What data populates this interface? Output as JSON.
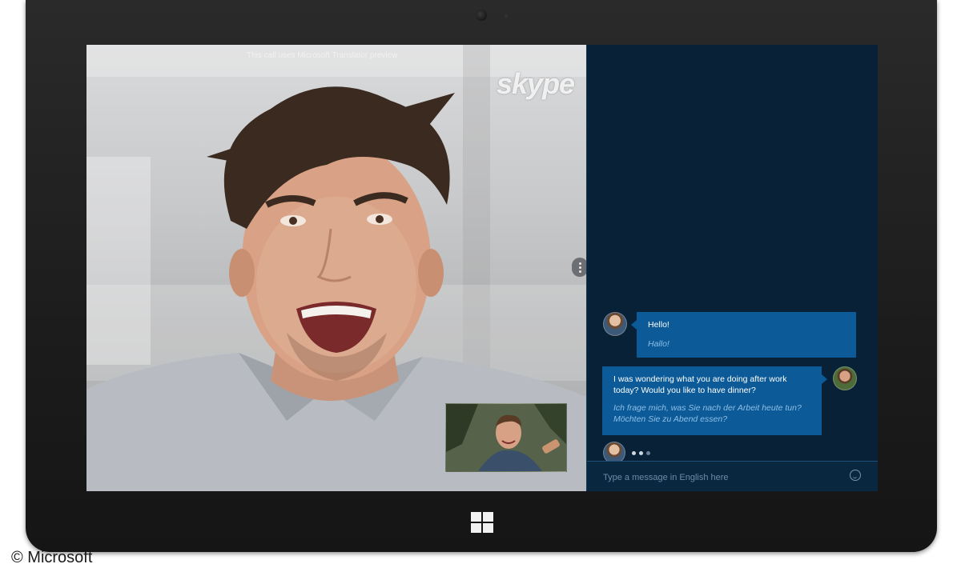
{
  "video": {
    "caption": "This call uses Microsoft Translator preview",
    "logo": "skype"
  },
  "chat": {
    "messages": [
      {
        "side": "left",
        "text": "Hello!",
        "translation": "Hallo!"
      },
      {
        "side": "right",
        "text": "I was wondering what you are doing after work today? Would you like to have dinner?",
        "translation": "Ich frage mich, was Sie nach der Arbeit heute tun? Möchten Sie zu Abend essen?"
      }
    ],
    "input_placeholder": "Type a message in English here"
  },
  "icons": {
    "smiley": "emoticon-icon",
    "windows": "windows-logo-icon",
    "handle": "more-options-icon"
  },
  "colors": {
    "chat_bg": "#082137",
    "bubble": "#0c5b98",
    "translation_text": "#8fbfe6"
  },
  "copyright": "© Microsoft"
}
